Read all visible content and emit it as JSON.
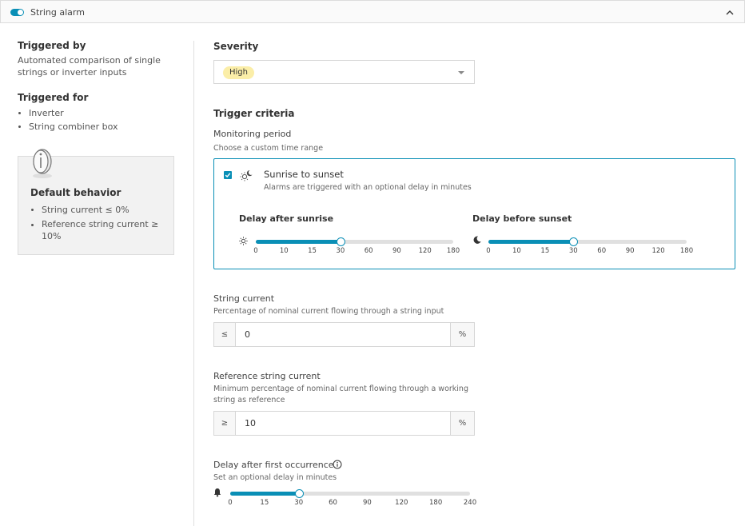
{
  "header": {
    "title": "String alarm",
    "toggle_on": true
  },
  "colors": {
    "accent": "#0a8fb6",
    "severity_badge": "#fbeea8"
  },
  "left": {
    "triggered_by_title": "Triggered by",
    "triggered_by_text": "Automated comparison of single strings or inverter inputs",
    "triggered_for_title": "Triggered for",
    "triggered_for_items": [
      "Inverter",
      "String combiner box"
    ],
    "default_title": "Default behavior",
    "default_items": [
      "String current ≤ 0%",
      "Reference string current ≥ 10%"
    ]
  },
  "severity": {
    "title": "Severity",
    "value": "High"
  },
  "trigger": {
    "title": "Trigger criteria",
    "period_label": "Monitoring period",
    "period_sub": "Choose a custom time range",
    "option_title": "Sunrise to sunset",
    "option_sub": "Alarms are triggered with an optional delay in minutes",
    "option_checked": true,
    "sunrise": {
      "label": "Delay after sunrise",
      "ticks": [
        "0",
        "10",
        "15",
        "30",
        "60",
        "90",
        "120",
        "180"
      ],
      "value_index": 3
    },
    "sunset": {
      "label": "Delay before sunset",
      "ticks": [
        "0",
        "10",
        "15",
        "30",
        "60",
        "90",
        "120",
        "180"
      ],
      "value_index": 3
    }
  },
  "string_current": {
    "label": "String current",
    "sub": "Percentage of nominal current flowing through a string input",
    "prefix": "≤",
    "value": "0",
    "suffix": "%"
  },
  "reference_current": {
    "label": "Reference string current",
    "sub": "Minimum percentage of nominal current flowing through a working string as reference",
    "prefix": "≥",
    "value": "10",
    "suffix": "%"
  },
  "first_occurrence": {
    "label": "Delay after first occurrence",
    "sub": "Set an optional delay in minutes",
    "ticks": [
      "0",
      "15",
      "30",
      "60",
      "90",
      "120",
      "180",
      "240"
    ],
    "value_index": 2
  },
  "icons": {
    "toggle": "toggle-switch-icon",
    "collapse": "chevron-up-icon",
    "info_illustration": "info-illustration-icon",
    "dropdown": "caret-down-icon",
    "sun_moon": "sun-moon-icon",
    "sun": "sun-icon",
    "moon": "moon-icon",
    "bell": "bell-icon",
    "info": "info-circle-icon"
  }
}
